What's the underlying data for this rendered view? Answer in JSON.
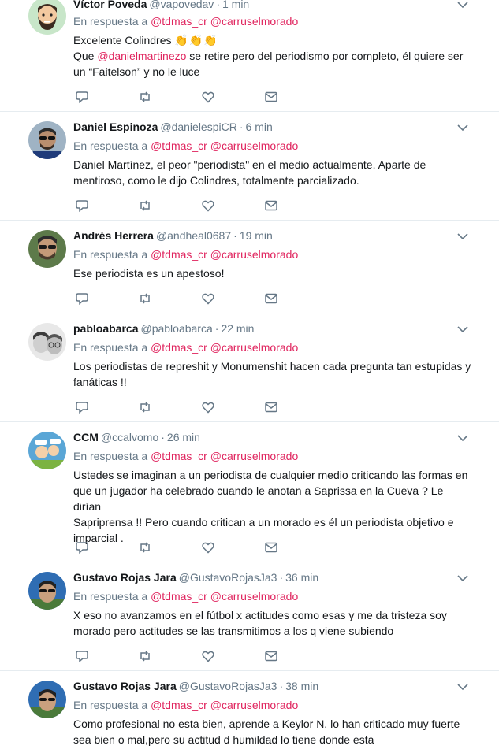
{
  "reply_prefix": "En respuesta a",
  "tweets": [
    {
      "name": "Víctor Poveda",
      "handle": "@vapovedav",
      "time": "1 min",
      "mentions": [
        "@tdmas_cr",
        "@carruselmorado"
      ],
      "avatar": "bearded-man-cartoon",
      "text_parts": {
        "l1": "Excelente Colindres",
        "l1_emoji": "👏👏👏",
        "l2_pre": "Que ",
        "l2_mention": "@danielmartinezo",
        "l2_post": " se retire pero del periodismo por completo, él quiere ser",
        "l3": "un “Faitelson” y no le luce"
      }
    },
    {
      "name": "Daniel Espinoza",
      "handle": "@danielespiCR",
      "time": "6 min",
      "mentions": [
        "@tdmas_cr",
        "@carruselmorado"
      ],
      "avatar": "man-sunglasses-photo",
      "lines": [
        "Daniel Martínez, el peor \"periodista\" en el medio actualmente. Aparte de",
        "mentiroso, como le dijo Colindres, totalmente parcializado."
      ]
    },
    {
      "name": "Andrés Herrera",
      "handle": "@andheal0687",
      "time": "19 min",
      "mentions": [
        "@tdmas_cr",
        "@carruselmorado"
      ],
      "avatar": "man-sunglasses-photo",
      "lines": [
        "Ese periodista es un apestoso!"
      ]
    },
    {
      "name": "pabloabarca",
      "handle": "@pabloabarca",
      "time": "22 min",
      "mentions": [
        "@tdmas_cr",
        "@carruselmorado"
      ],
      "avatar": "couple-photo",
      "lines": [
        "Los periodistas de represhit y Monumenshit hacen cada pregunta tan estupidas y",
        "fanáticas !!"
      ]
    },
    {
      "name": "CCM",
      "handle": "@ccalvomo",
      "time": "26 min",
      "mentions": [
        "@tdmas_cr",
        "@carruselmorado"
      ],
      "avatar": "cartoon-blue-sky",
      "lines": [
        "Ustedes se imaginan a un periodista de cualquier medio criticando las formas en",
        "que un jugador ha celebrado cuando le anotan a Saprissa en la Cueva ?  Le dirían",
        "Sapriprensa !! Pero cuando critican a un morado es él un periodista objetivo e",
        "imparcial ."
      ]
    },
    {
      "name": "Gustavo Rojas Jara",
      "handle": "@GustavoRojasJa3",
      "time": "36 min",
      "mentions": [
        "@tdmas_cr",
        "@carruselmorado"
      ],
      "avatar": "man-outdoor-photo",
      "lines": [
        "X eso no avanzamos en el fútbol x actitudes como esas y me da tristeza soy",
        "morado pero actitudes se las transmitimos a los q viene subiendo"
      ]
    },
    {
      "name": "Gustavo Rojas Jara",
      "handle": "@GustavoRojasJa3",
      "time": "38 min",
      "mentions": [
        "@tdmas_cr",
        "@carruselmorado"
      ],
      "avatar": "man-outdoor-photo",
      "lines": [
        "Como profesional no esta bien, aprende a Keylor N, lo han criticado muy fuerte",
        "sea bien o mal,pero su actitud d humildad lo tiene donde esta"
      ]
    }
  ]
}
